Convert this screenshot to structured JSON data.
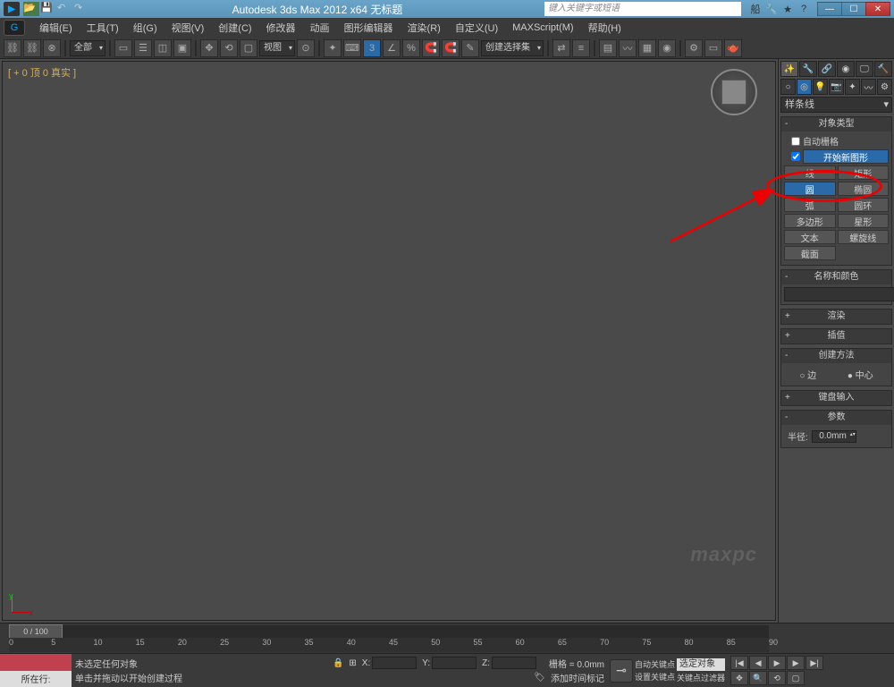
{
  "title": "Autodesk 3ds Max 2012 x64   无标题",
  "search_placeholder": "键入关键字或短语",
  "menus": [
    "编辑(E)",
    "工具(T)",
    "组(G)",
    "视图(V)",
    "创建(C)",
    "修改器",
    "动画",
    "图形编辑器",
    "渲染(R)",
    "自定义(U)",
    "MAXScript(M)",
    "帮助(H)"
  ],
  "toolbar": {
    "all": "全部",
    "view": "视图",
    "createSel": "创建选择集"
  },
  "viewport_label": "[ + 0 顶 0 真实 ]",
  "panel": {
    "dropdown": "样条线",
    "objtype_head": "对象类型",
    "autogrid": "自动栅格",
    "startnew": "开始新图形",
    "buttons": [
      [
        "线",
        "矩形"
      ],
      [
        "圆",
        "椭圆"
      ],
      [
        "弧",
        "圆环"
      ],
      [
        "多边形",
        "星形"
      ],
      [
        "文本",
        "螺旋线"
      ],
      [
        "截面",
        ""
      ]
    ],
    "name_head": "名称和颜色",
    "render_head": "渲染",
    "interp_head": "插值",
    "method_head": "创建方法",
    "m_edge": "边",
    "m_center": "中心",
    "keyboard_head": "键盘输入",
    "params_head": "参数",
    "radius_label": "半径:",
    "radius_value": "0.0mm"
  },
  "timeline": {
    "slider": "0 / 100",
    "ticks": [
      "0",
      "5",
      "10",
      "15",
      "20",
      "25",
      "30",
      "35",
      "40",
      "45",
      "50",
      "55",
      "60",
      "65",
      "70",
      "75",
      "80",
      "85",
      "90"
    ]
  },
  "status": {
    "none_selected": "未选定任何对象",
    "drag_hint": "单击并拖动以开始创建过程",
    "add_time_tag": "添加时间标记",
    "row_label": "所在行:",
    "grid": "栅格 = 0.0mm",
    "auto_key": "自动关键点",
    "set_key": "设置关键点",
    "sel_obj": "选定对象",
    "key_filter": "关键点过滤器",
    "x": "X:",
    "y": "Y:",
    "z": "Z:"
  },
  "watermark": "maxpc"
}
